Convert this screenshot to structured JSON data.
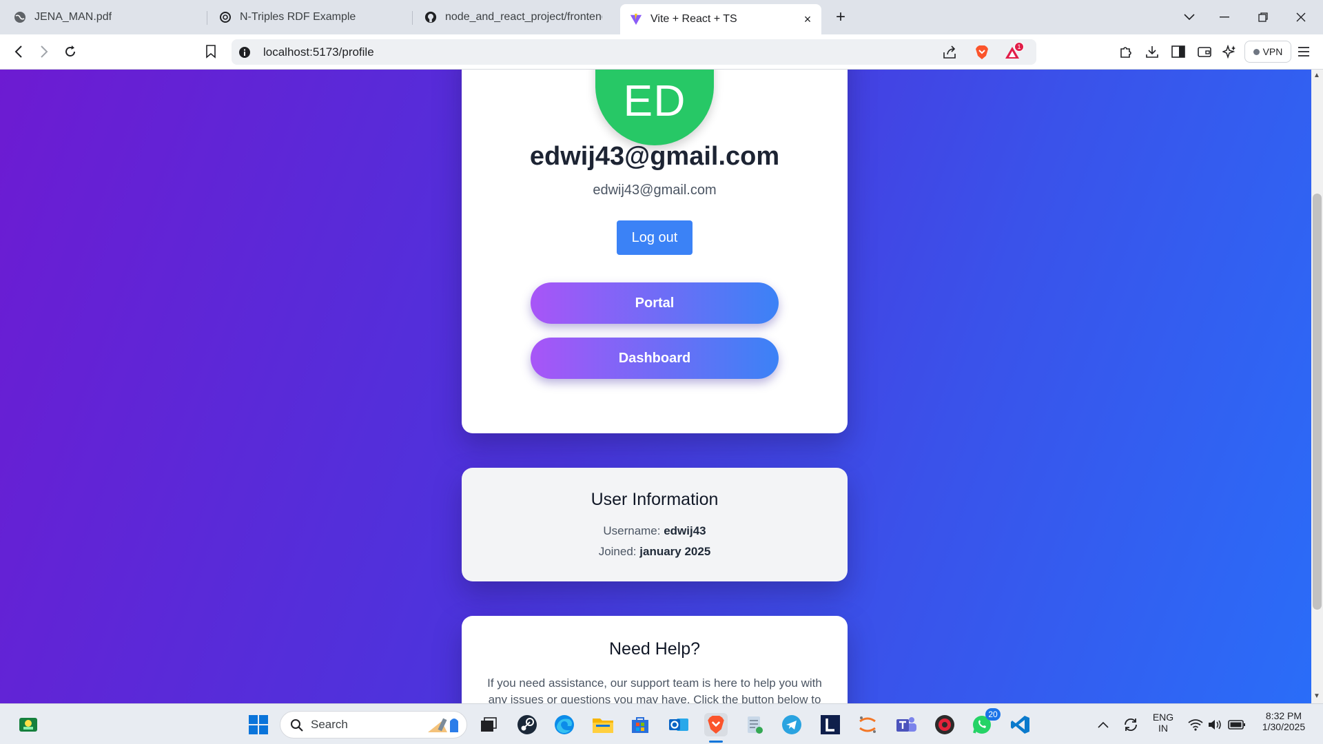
{
  "browser": {
    "tabs": [
      {
        "label": "JENA_MAN.pdf",
        "icon": "globe-icon",
        "active": false
      },
      {
        "label": "N-Triples RDF Example",
        "icon": "openai-icon",
        "active": false
      },
      {
        "label": "node_and_react_project/frontend/sr",
        "icon": "github-icon",
        "active": false
      },
      {
        "label": "Vite + React + TS",
        "icon": "vite-icon",
        "active": true
      }
    ],
    "new_tab": "+",
    "close_tab": "×",
    "url": "localhost:5173/profile",
    "vpn_label": "VPN",
    "rewards_badge": "1"
  },
  "page": {
    "avatar_initials": "ED",
    "profile_name": "edwij43@gmail.com",
    "profile_email": "edwij43@gmail.com",
    "logout_label": "Log out",
    "portal_label": "Portal",
    "dashboard_label": "Dashboard",
    "info": {
      "title": "User Information",
      "username_label": "Username:",
      "username_value": "edwij43",
      "joined_label": "Joined:",
      "joined_value": "january 2025"
    },
    "help": {
      "title": "Need Help?",
      "text": "If you need assistance, our support team is here to help you with any issues or questions you may have. Click the button below to"
    }
  },
  "taskbar": {
    "search_placeholder": "Search",
    "whatsapp_badge": "20",
    "lang_top": "ENG",
    "lang_bottom": "IN",
    "time": "8:32 PM",
    "date": "1/30/2025"
  },
  "colors": {
    "avatar": "#27c866",
    "logout": "#3b82f6",
    "gradient_start": "#a855f7",
    "gradient_end": "#3b82f6",
    "page_bg_start": "#6d1bd2",
    "page_bg_end": "#2a6df8"
  }
}
